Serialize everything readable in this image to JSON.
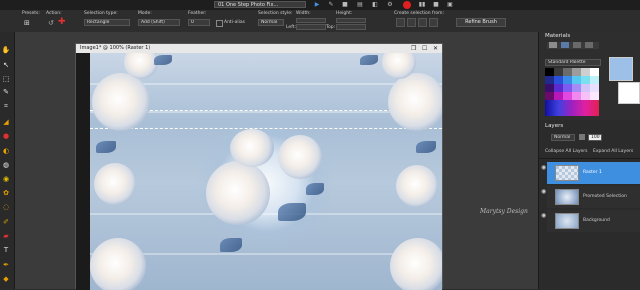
{
  "scriptbar": {
    "script_name": "01 One Step Photo Fix..."
  },
  "options": {
    "presets_label": "Presets:",
    "action_label": "Action:",
    "selection_type_label": "Selection type:",
    "selection_type_value": "Rectangle",
    "mode_label": "Mode:",
    "mode_value": "Add (Shift)",
    "feather_label": "Feather:",
    "feather_value": "0",
    "antialias_label": "Anti-alias",
    "selection_style_label": "Selection style:",
    "selection_style_value": "Normal",
    "width_label": "Width:",
    "height_label": "Height:",
    "left_label": "Left:",
    "top_label": "Top:",
    "create_from_label": "Create selection from:",
    "refine_label": "Refine Brush"
  },
  "image_window": {
    "title": "Image1* @ 100% (Raster 1)",
    "watermark": "Marytsy Design"
  },
  "materials": {
    "title": "Materials",
    "palette_select": "Standard Palette",
    "foreground_color": "#9cc0e8",
    "background_color": "#ffffff"
  },
  "layers": {
    "title": "Layers",
    "blend_mode": "Normal",
    "opacity": "100",
    "collapse_label": "Collapse All Layers",
    "expand_label": "Expand All Layers",
    "items": [
      {
        "name": "Raster 1"
      },
      {
        "name": "Promoted Selection"
      },
      {
        "name": "Background"
      }
    ]
  }
}
